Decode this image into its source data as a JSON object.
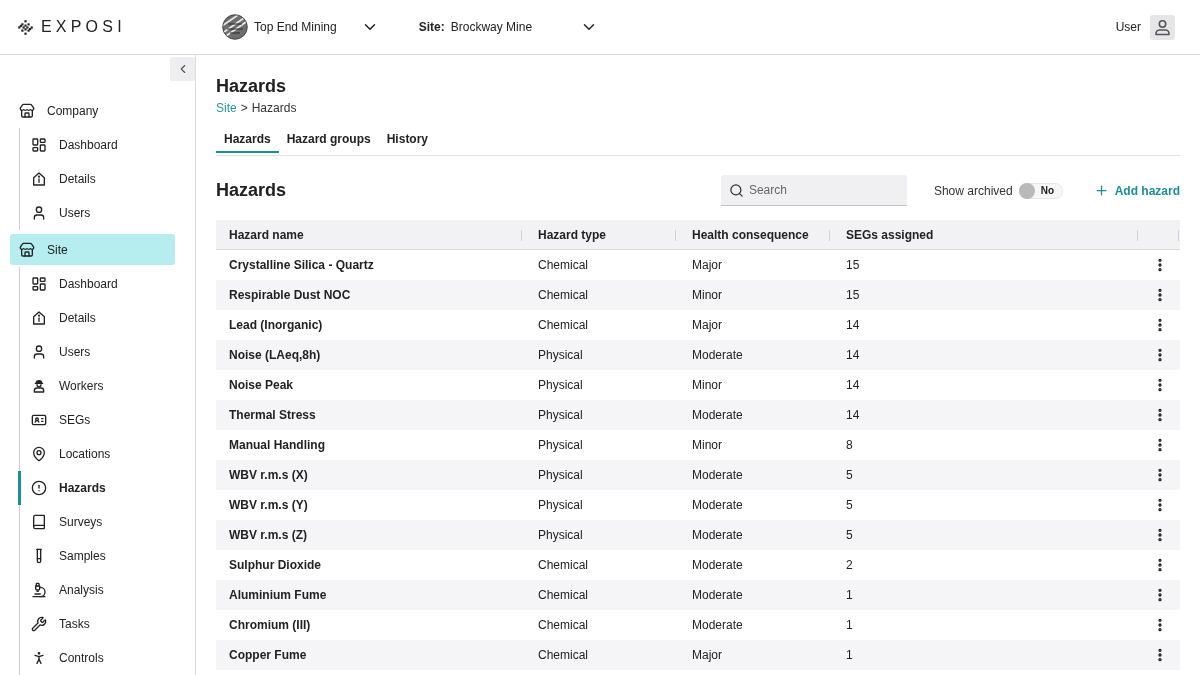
{
  "brand": {
    "name": "EXPOSI"
  },
  "header": {
    "organization": "Top End Mining",
    "site_label": "Site:",
    "site": "Brockway Mine",
    "user": "User"
  },
  "sidebar": {
    "sections": [
      {
        "label": "Company",
        "selected": false,
        "items": [
          {
            "label": "Dashboard",
            "selected": false
          },
          {
            "label": "Details",
            "selected": false
          },
          {
            "label": "Users",
            "selected": false
          }
        ]
      },
      {
        "label": "Site",
        "selected": true,
        "items": [
          {
            "label": "Dashboard",
            "selected": false
          },
          {
            "label": "Details",
            "selected": false
          },
          {
            "label": "Users",
            "selected": false
          },
          {
            "label": "Workers",
            "selected": false
          },
          {
            "label": "SEGs",
            "selected": false
          },
          {
            "label": "Locations",
            "selected": false
          },
          {
            "label": "Hazards",
            "selected": true
          },
          {
            "label": "Surveys",
            "selected": false
          },
          {
            "label": "Samples",
            "selected": false
          },
          {
            "label": "Analysis",
            "selected": false
          },
          {
            "label": "Tasks",
            "selected": false
          },
          {
            "label": "Controls",
            "selected": false
          }
        ]
      }
    ]
  },
  "page": {
    "title": "Hazards",
    "breadcrumb": {
      "parent": "Site",
      "separator": ">",
      "current": "Hazards"
    },
    "tabs": [
      {
        "label": "Hazards",
        "selected": true
      },
      {
        "label": "Hazard groups",
        "selected": false
      },
      {
        "label": "History",
        "selected": false
      }
    ],
    "section_title": "Hazards",
    "search": {
      "placeholder": "Search"
    },
    "show_archived": {
      "label": "Show archived",
      "on": false,
      "state_text": "No"
    },
    "add_button": "Add hazard"
  },
  "table": {
    "columns": [
      "Hazard name",
      "Hazard type",
      "Health consequence",
      "SEGs assigned"
    ],
    "rows": [
      {
        "hazard_name": "Crystalline Silica - Quartz",
        "hazard_type": "Chemical",
        "health_consequence": "Major",
        "segs_assigned": "15"
      },
      {
        "hazard_name": "Respirable Dust NOC",
        "hazard_type": "Chemical",
        "health_consequence": "Minor",
        "segs_assigned": "15"
      },
      {
        "hazard_name": "Lead (Inorganic)",
        "hazard_type": "Chemical",
        "health_consequence": "Major",
        "segs_assigned": "14"
      },
      {
        "hazard_name": "Noise (LAeq,8h)",
        "hazard_type": "Physical",
        "health_consequence": "Moderate",
        "segs_assigned": "14"
      },
      {
        "hazard_name": "Noise Peak",
        "hazard_type": "Physical",
        "health_consequence": "Minor",
        "segs_assigned": "14"
      },
      {
        "hazard_name": "Thermal Stress",
        "hazard_type": "Physical",
        "health_consequence": "Moderate",
        "segs_assigned": "14"
      },
      {
        "hazard_name": "Manual Handling",
        "hazard_type": "Physical",
        "health_consequence": "Minor",
        "segs_assigned": "8"
      },
      {
        "hazard_name": "WBV r.m.s (X)",
        "hazard_type": "Physical",
        "health_consequence": "Moderate",
        "segs_assigned": "5"
      },
      {
        "hazard_name": "WBV r.m.s (Y)",
        "hazard_type": "Physical",
        "health_consequence": "Moderate",
        "segs_assigned": "5"
      },
      {
        "hazard_name": "WBV r.m.s (Z)",
        "hazard_type": "Physical",
        "health_consequence": "Moderate",
        "segs_assigned": "5"
      },
      {
        "hazard_name": "Sulphur Dioxide",
        "hazard_type": "Chemical",
        "health_consequence": "Moderate",
        "segs_assigned": "2"
      },
      {
        "hazard_name": "Aluminium Fume",
        "hazard_type": "Chemical",
        "health_consequence": "Moderate",
        "segs_assigned": "1"
      },
      {
        "hazard_name": "Chromium (III)",
        "hazard_type": "Chemical",
        "health_consequence": "Moderate",
        "segs_assigned": "1"
      },
      {
        "hazard_name": "Copper Fume",
        "hazard_type": "Chemical",
        "health_consequence": "Major",
        "segs_assigned": "1"
      }
    ]
  }
}
